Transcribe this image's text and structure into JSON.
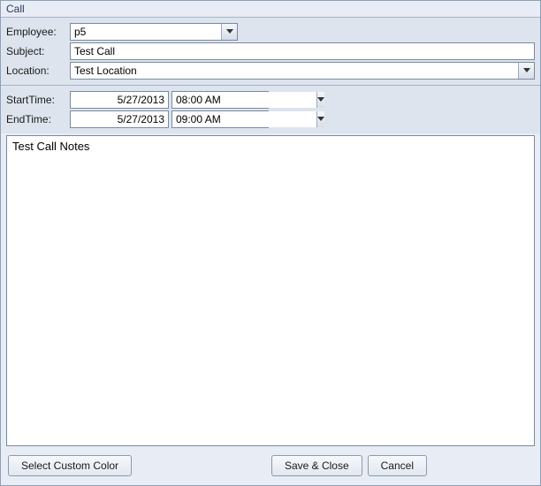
{
  "window": {
    "title": "Call"
  },
  "fields": {
    "employee": {
      "label": "Employee:",
      "value": "p5"
    },
    "subject": {
      "label": "Subject:",
      "value": "Test Call"
    },
    "location": {
      "label": "Location:",
      "value": "Test Location"
    },
    "startTime": {
      "label": "StartTime:",
      "date": "5/27/2013",
      "time": "08:00 AM"
    },
    "endTime": {
      "label": "EndTime:",
      "date": "5/27/2013",
      "time": "09:00 AM"
    }
  },
  "notes": {
    "value": "Test Call Notes"
  },
  "buttons": {
    "selectColor": "Select Custom Color",
    "saveClose": "Save & Close",
    "cancel": "Cancel"
  }
}
